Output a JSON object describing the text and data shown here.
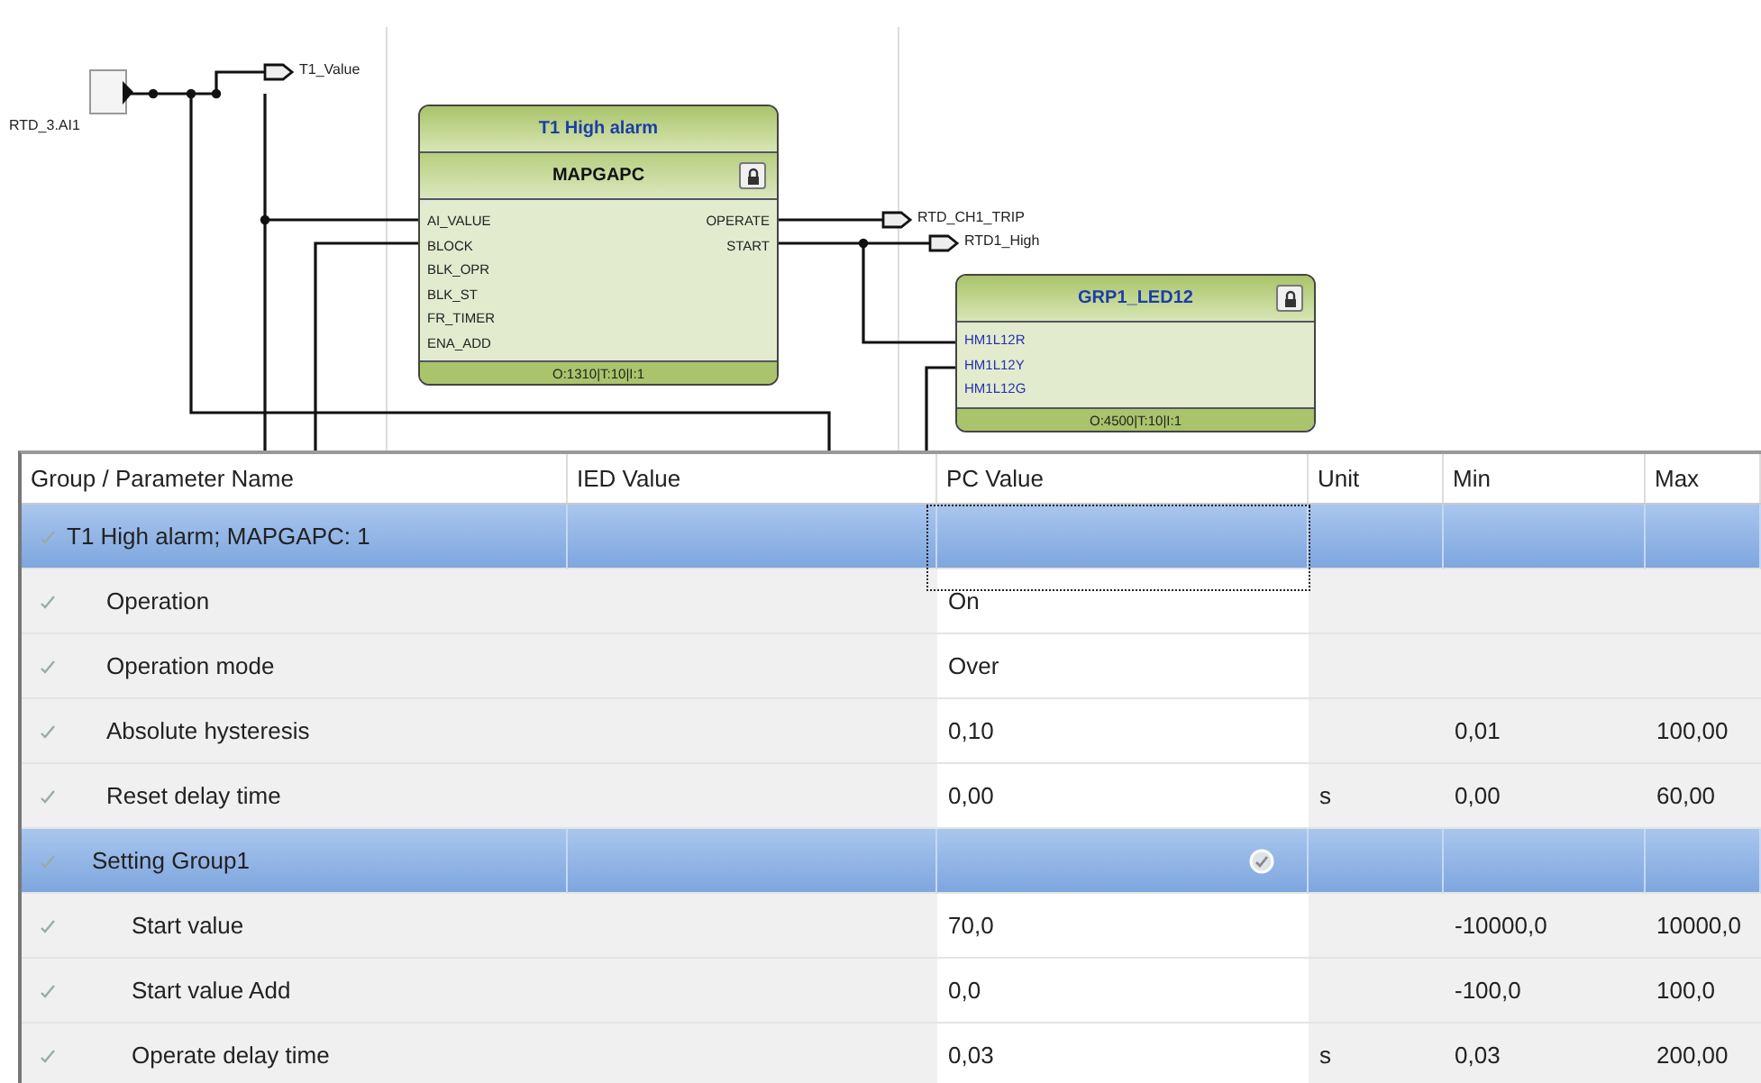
{
  "diagram": {
    "inputs": [
      {
        "label": "RTD_3.AI1"
      }
    ],
    "outputs": [
      {
        "label": "T1_Value"
      },
      {
        "label": "RTD_CH1_TRIP"
      },
      {
        "label": "RTD1_High"
      }
    ],
    "blocks": [
      {
        "title": "T1 High alarm",
        "type": "MAPGAPC",
        "locked": true,
        "inputs": [
          "AI_VALUE",
          "BLOCK",
          "BLK_OPR",
          "BLK_ST",
          "FR_TIMER",
          "ENA_ADD"
        ],
        "outputs": [
          "OPERATE",
          "START"
        ],
        "footer": "O:1310|T:10|I:1"
      },
      {
        "title": "GRP1_LED12",
        "locked": true,
        "inputs": [
          "HM1L12R",
          "HM1L12Y",
          "HM1L12G"
        ],
        "footer": "O:4500|T:10|I:1"
      }
    ]
  },
  "table": {
    "columns": [
      "Group / Parameter Name",
      "IED Value",
      "PC Value",
      "Unit",
      "Min",
      "Max"
    ],
    "rows": [
      {
        "kind": "group",
        "name": "T1 High alarm; MAPGAPC: 1",
        "focused": true,
        "confirmed": false,
        "children": [
          {
            "kind": "param",
            "name": "Operation",
            "pc": "On"
          },
          {
            "kind": "param",
            "name": "Operation mode",
            "pc": "Over"
          },
          {
            "kind": "param",
            "name": "Absolute hysteresis",
            "pc": "0,10",
            "min": "0,01",
            "max": "100,00"
          },
          {
            "kind": "param",
            "name": "Reset delay time",
            "pc": "0,00",
            "unit": "s",
            "min": "0,00",
            "max": "60,00"
          },
          {
            "kind": "group",
            "name": "Setting Group1",
            "focused": false,
            "confirmed": true,
            "children": [
              {
                "kind": "param",
                "name": "Start value",
                "pc": "70,0",
                "min": "-10000,0",
                "max": "10000,0"
              },
              {
                "kind": "param",
                "name": "Start value Add",
                "pc": "0,0",
                "min": "-100,0",
                "max": "100,0"
              },
              {
                "kind": "param",
                "name": "Operate delay time",
                "pc": "0,03",
                "unit": "s",
                "min": "0,03",
                "max": "200,00"
              }
            ]
          }
        ]
      }
    ]
  }
}
